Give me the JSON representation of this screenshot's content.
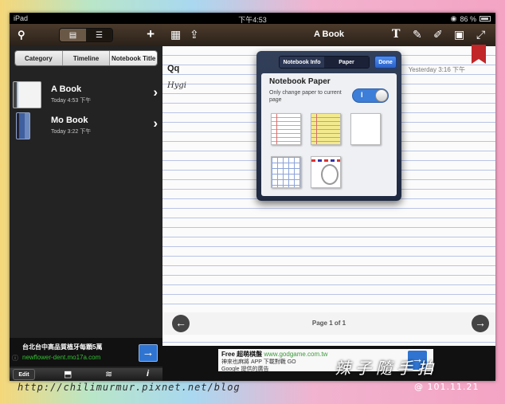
{
  "status": {
    "device": "iPad",
    "time": "下午4:53",
    "battery": "86 %"
  },
  "sidebar": {
    "tabs": [
      "Category",
      "Timeline",
      "Notebook Title"
    ],
    "selected_tab": "Notebook Title",
    "books": [
      {
        "title": "A Book",
        "date": "Today 4:53 下午"
      },
      {
        "title": "Mo Book",
        "date": "Today 3:22 下午"
      }
    ],
    "ad": {
      "line1": "台北台中高品質植牙每顆5萬",
      "line2": "newflower-dent.mo17a.com"
    },
    "edit_label": "Edit"
  },
  "notebook": {
    "title": "A Book",
    "first_line": "Qq",
    "handwriting": "Hygi",
    "date": "Yesterday 3:16 下午",
    "page_label": "Page 1 of 1"
  },
  "popover": {
    "tabs": [
      "Notebook Info",
      "Paper"
    ],
    "selected_tab": "Paper",
    "done_label": "Done",
    "title": "Notebook Paper",
    "subtitle": "Only change paper to current page",
    "toggle_mark": "I",
    "toggle_on": true,
    "papers": [
      "lined-white",
      "lined-yellow",
      "plain",
      "grid",
      "airmail"
    ]
  },
  "ad_main": {
    "line1": "Free 超萌棋盤",
    "url": "www.godgame.com.tw",
    "line2": "神來也麻將 APP 下載對戰 GO",
    "line3": "Google 提供的廣告"
  },
  "watermark": {
    "blog": "http://chilimurmur.pixnet.net/blog",
    "signature": "辣子隨手拍",
    "date": "@ 101.11.21"
  },
  "colors": {
    "accent": "#2f74d0",
    "ribbon": "#c12628",
    "toggle": "#3c7ed8"
  }
}
